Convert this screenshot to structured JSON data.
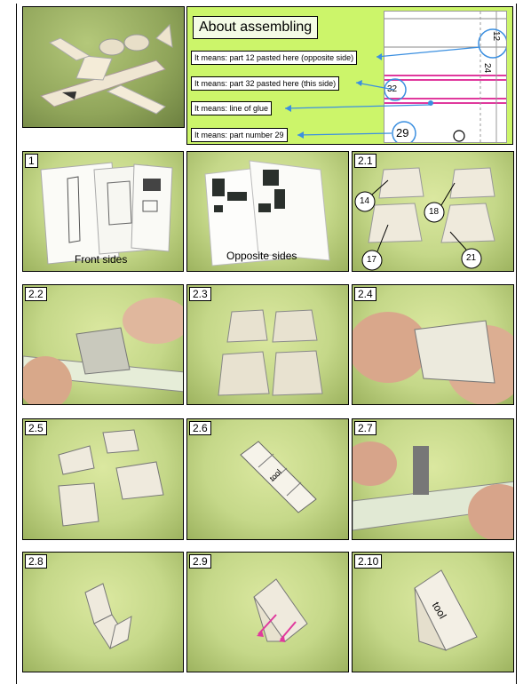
{
  "legend": {
    "title": "About assembling",
    "notes": [
      "It means: part 12 pasted here (opposite side)",
      "It means: part 32 pasted here (this side)",
      "It means: line of glue",
      "It means: part number 29"
    ],
    "sheet_marks": {
      "m12": "12",
      "m24": "24",
      "m32": "32",
      "m29": "29"
    }
  },
  "steps": {
    "s1": {
      "tag": "1",
      "caption": "Front sides"
    },
    "s1b": {
      "caption": "Opposite sides"
    },
    "s21": {
      "tag": "2.1",
      "parts": [
        "14",
        "18",
        "17",
        "21"
      ]
    },
    "s22": {
      "tag": "2.2"
    },
    "s23": {
      "tag": "2.3"
    },
    "s24": {
      "tag": "2.4"
    },
    "s25": {
      "tag": "2.5"
    },
    "s26": {
      "tag": "2.6",
      "print": "tool"
    },
    "s27": {
      "tag": "2.7"
    },
    "s28": {
      "tag": "2.8"
    },
    "s29": {
      "tag": "2.9"
    },
    "s210": {
      "tag": "2.10",
      "print": "tool"
    }
  },
  "colors": {
    "photo_bg": "#c5d889",
    "legend_bg": "#ccf56a",
    "arrow": "#3b8fe0",
    "magenta": "#e0399d"
  }
}
